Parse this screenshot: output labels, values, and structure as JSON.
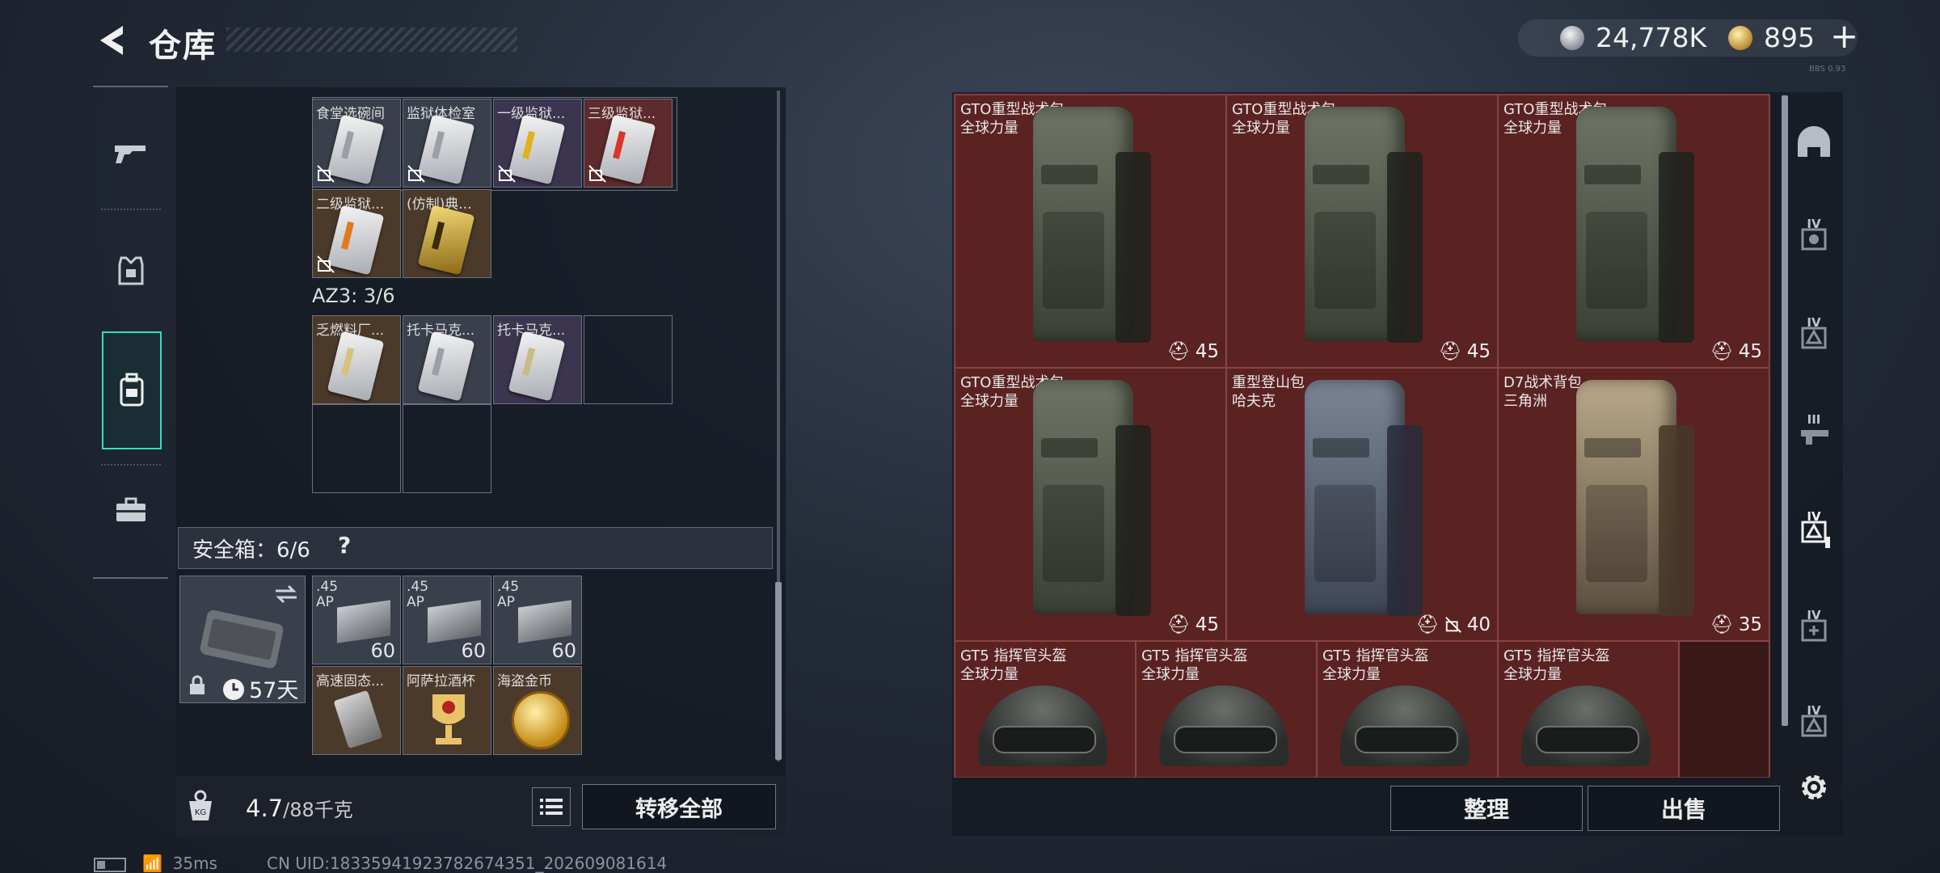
{
  "header": {
    "title": "仓库",
    "ver": "BBS 0.93"
  },
  "currency": {
    "silver": "24,778K",
    "gold": "895",
    "add": "+"
  },
  "sidebar": {
    "tabs": [
      "weapons",
      "armor",
      "backpack",
      "toolbox"
    ]
  },
  "left_panel": {
    "keycards_row1": [
      "食堂选碗间",
      "监狱体检室",
      "一级监狱...",
      "三级监狱..."
    ],
    "keycards_row2": [
      "二级监狱...",
      "(仿制)典..."
    ],
    "az3_label": "AZ3: 3/6",
    "az3_items": [
      "乏燃料厂...",
      "托卡马克...",
      "托卡马克..."
    ],
    "safe_box": {
      "label": "安全箱：6/6",
      "help": "?",
      "remaining": "57天"
    },
    "safe_items": [
      {
        "name": ".45",
        "sub": "AP",
        "count": "60"
      },
      {
        "name": ".45",
        "sub": "AP",
        "count": "60"
      },
      {
        "name": ".45",
        "sub": "AP",
        "count": "60"
      },
      {
        "name": "高速固态...",
        "sub": "",
        "count": ""
      },
      {
        "name": "阿萨拉酒杯",
        "sub": "",
        "count": ""
      },
      {
        "name": "海盗金币",
        "sub": "",
        "count": ""
      }
    ],
    "weight": "4.7",
    "weight_max": "/88千克",
    "transfer_all": "转移全部"
  },
  "right_panel": {
    "items": [
      {
        "name": "GTO重型战术包",
        "brand": "全球力量",
        "cap": "45"
      },
      {
        "name": "GTO重型战术包",
        "brand": "全球力量",
        "cap": "45"
      },
      {
        "name": "GTO重型战术包",
        "brand": "全球力量",
        "cap": "45"
      },
      {
        "name": "GTO重型战术包",
        "brand": "全球力量",
        "cap": "45"
      },
      {
        "name": "重型登山包",
        "brand": "哈夫克",
        "cap": "40"
      },
      {
        "name": "D7战术背包",
        "brand": "三角洲",
        "cap": "35"
      }
    ],
    "helmets": [
      {
        "name": "GT5 指挥官头盔",
        "brand": "全球力量"
      },
      {
        "name": "GT5 指挥官头盔",
        "brand": "全球力量"
      },
      {
        "name": "GT5 指挥官头盔",
        "brand": "全球力量"
      },
      {
        "name": "GT5 指挥官头盔",
        "brand": "全球力量"
      }
    ],
    "sort": "整理",
    "sell": "出售",
    "rail_tiers": [
      "IV",
      "IV",
      "III",
      "IV",
      "IV",
      "IV"
    ]
  },
  "status": {
    "ping": "35ms",
    "uid": "CN UID:18335941923782674351_202609081614"
  },
  "colors": {
    "accent": "#2ee0c2",
    "item_red": "#5b2222"
  }
}
